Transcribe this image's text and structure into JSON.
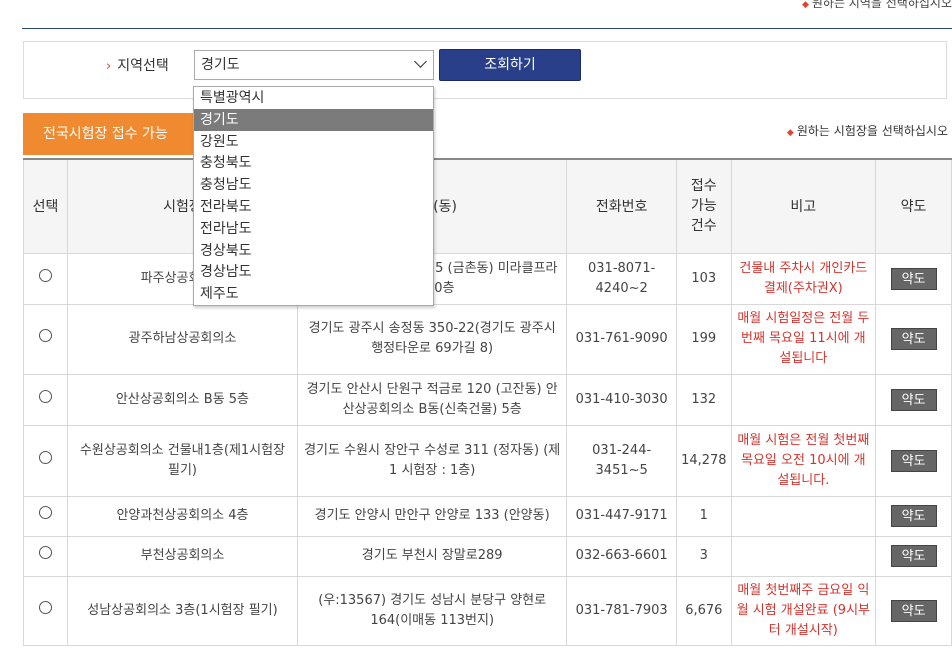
{
  "top_note": "원하는 지역을 선택하십시오",
  "search": {
    "label": "지역선택",
    "selected": "경기도",
    "button": "조회하기",
    "options": [
      "특별광역시",
      "경기도",
      "강원도",
      "충청북도",
      "충청남도",
      "전라북도",
      "전라남도",
      "경상북도",
      "경상남도",
      "제주도"
    ]
  },
  "tab_label": "전국시험장 접수 가능",
  "right_note": "원하는 시험장을 선택하십시오",
  "table": {
    "headers": [
      "선택",
      "시험장",
      "주소(동)",
      "전화번호",
      "접수 가능 건수",
      "비고",
      "약도"
    ],
    "map_label": "약도",
    "rows": [
      {
        "name": "파주상공회의소",
        "address": "경기도 파주시 금정로 15 (금촌동) 미라클프라자 10층",
        "phone": "031-8071-4240~2",
        "count": "103",
        "note": "건물내 주차시 개인카드 결제(주차권X)"
      },
      {
        "name": "광주하남상공회의소",
        "address": "경기도 광주시 송정동 350-22(경기도 광주시 행정타운로 69가길 8)",
        "phone": "031-761-9090",
        "count": "199",
        "note": "매월 시험일정은 전월 두번째 목요일 11시에 개설됩니다"
      },
      {
        "name": "안산상공회의소 B동 5층",
        "address": "경기도 안산시 단원구 적금로 120 (고잔동) 안산상공회의소 B동(신축건물) 5층",
        "phone": "031-410-3030",
        "count": "132",
        "note": ""
      },
      {
        "name": "수원상공회의소 건물내1층(제1시험장 필기)",
        "address": "경기도 수원시 장안구 수성로 311 (정자동) (제 1 시험장 : 1층)",
        "phone": "031-244-3451~5",
        "count": "14,278",
        "note": "매월 시험은 전월 첫번째 목요일 오전 10시에 개설됩니다."
      },
      {
        "name": "안양과천상공회의소 4층",
        "address": "경기도 안양시 만안구 안양로 133 (안양동)",
        "phone": "031-447-9171",
        "count": "1",
        "note": ""
      },
      {
        "name": "부천상공회의소",
        "address": "경기도 부천시 장말로289",
        "phone": "032-663-6601",
        "count": "3",
        "note": ""
      },
      {
        "name": "성남상공회의소 3층(1시험장 필기)",
        "address": "(우:13567) 경기도 성남시 분당구 양현로 164(이매동 113번지)",
        "phone": "031-781-7903",
        "count": "6,676",
        "note": "매월 첫번째주 금요일 익월 시험 개설완료 (9시부터 개설시작)"
      }
    ]
  }
}
